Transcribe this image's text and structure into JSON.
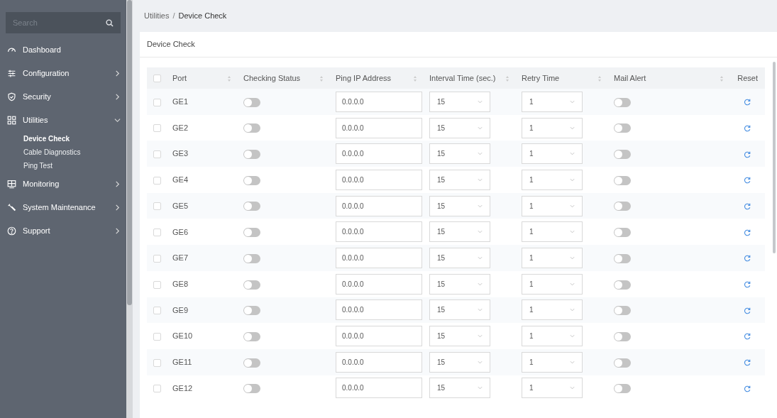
{
  "sidebar": {
    "search": {
      "placeholder": "Search"
    },
    "items": [
      {
        "label": "Dashboard",
        "has_submenu": false
      },
      {
        "label": "Configuration",
        "has_submenu": true,
        "expanded": false
      },
      {
        "label": "Security",
        "has_submenu": true,
        "expanded": false
      },
      {
        "label": "Utilities",
        "has_submenu": true,
        "expanded": true,
        "children": [
          {
            "label": "Device Check",
            "selected": true
          },
          {
            "label": "Cable Diagnostics",
            "selected": false
          },
          {
            "label": "Ping Test",
            "selected": false
          }
        ]
      },
      {
        "label": "Monitoring",
        "has_submenu": true,
        "expanded": false
      },
      {
        "label": "System Maintenance",
        "has_submenu": true,
        "expanded": false
      },
      {
        "label": "Support",
        "has_submenu": true,
        "expanded": false
      }
    ]
  },
  "breadcrumb": {
    "separator": "/",
    "items": [
      "Utilities",
      "Device Check"
    ]
  },
  "card": {
    "title": "Device Check"
  },
  "table": {
    "select_all": {
      "checked": false
    },
    "columns": [
      "Port",
      "Checking Status",
      "Ping IP Address",
      "Interval Time (sec.)",
      "Retry Time",
      "Mail Alert",
      "Reset"
    ],
    "rows": [
      {
        "checked": false,
        "port": "GE1",
        "checking_status": false,
        "ping_ip": "0.0.0.0",
        "interval": "15",
        "retry": "1",
        "mail_alert": false
      },
      {
        "checked": false,
        "port": "GE2",
        "checking_status": false,
        "ping_ip": "0.0.0.0",
        "interval": "15",
        "retry": "1",
        "mail_alert": false
      },
      {
        "checked": false,
        "port": "GE3",
        "checking_status": false,
        "ping_ip": "0.0.0.0",
        "interval": "15",
        "retry": "1",
        "mail_alert": false
      },
      {
        "checked": false,
        "port": "GE4",
        "checking_status": false,
        "ping_ip": "0.0.0.0",
        "interval": "15",
        "retry": "1",
        "mail_alert": false
      },
      {
        "checked": false,
        "port": "GE5",
        "checking_status": false,
        "ping_ip": "0.0.0.0",
        "interval": "15",
        "retry": "1",
        "mail_alert": false
      },
      {
        "checked": false,
        "port": "GE6",
        "checking_status": false,
        "ping_ip": "0.0.0.0",
        "interval": "15",
        "retry": "1",
        "mail_alert": false
      },
      {
        "checked": false,
        "port": "GE7",
        "checking_status": false,
        "ping_ip": "0.0.0.0",
        "interval": "15",
        "retry": "1",
        "mail_alert": false
      },
      {
        "checked": false,
        "port": "GE8",
        "checking_status": false,
        "ping_ip": "0.0.0.0",
        "interval": "15",
        "retry": "1",
        "mail_alert": false
      },
      {
        "checked": false,
        "port": "GE9",
        "checking_status": false,
        "ping_ip": "0.0.0.0",
        "interval": "15",
        "retry": "1",
        "mail_alert": false
      },
      {
        "checked": false,
        "port": "GE10",
        "checking_status": false,
        "ping_ip": "0.0.0.0",
        "interval": "15",
        "retry": "1",
        "mail_alert": false
      },
      {
        "checked": false,
        "port": "GE11",
        "checking_status": false,
        "ping_ip": "0.0.0.0",
        "interval": "15",
        "retry": "1",
        "mail_alert": false
      },
      {
        "checked": false,
        "port": "GE12",
        "checking_status": false,
        "ping_ip": "0.0.0.0",
        "interval": "15",
        "retry": "1",
        "mail_alert": false
      }
    ]
  }
}
